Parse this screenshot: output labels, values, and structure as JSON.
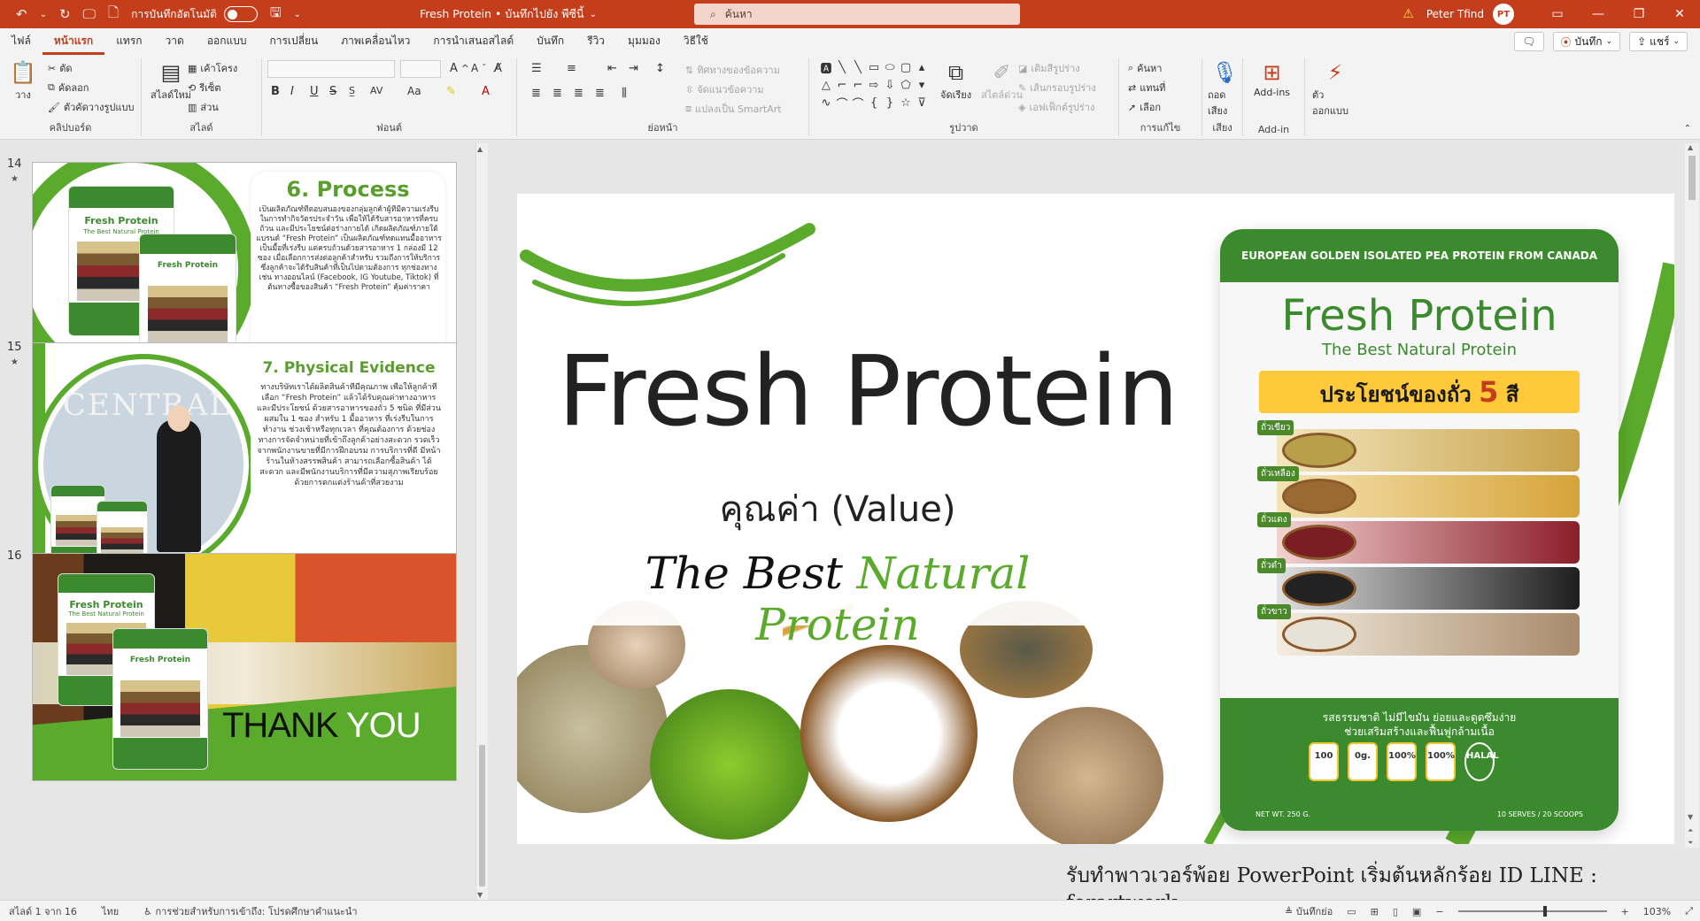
{
  "titlebar": {
    "autosave_label": "การบันทึกอัตโนมัติ",
    "doc_title": "Fresh Protein  •  บันทึกไปยัง พีซีนี้",
    "search_placeholder": "ค้นหา",
    "warning_icon": "warning-icon",
    "user_name": "Peter Tfind",
    "user_initials": "PT"
  },
  "tabs": [
    "ไฟล์",
    "หน้าแรก",
    "แทรก",
    "วาด",
    "ออกแบบ",
    "การเปลี่ยน",
    "ภาพเคลื่อนไหว",
    "การนำเสนอสไลด์",
    "บันทึก",
    "รีวิว",
    "มุมมอง",
    "วิธีใช้"
  ],
  "active_tab": "หน้าแรก",
  "tabs_right": {
    "comment_icon": "comment-icon",
    "record_label": "บันทึก",
    "share_label": "แชร์"
  },
  "ribbon": {
    "clipboard": {
      "label": "คลิปบอร์ด",
      "paste": "วาง",
      "cut": "ตัด",
      "copy": "คัดลอก",
      "format_painter": "ตัวคัดวางรูปแบบ"
    },
    "slides": {
      "label": "สไลด์",
      "new_slide": "สไลด์ใหม่",
      "layout": "เค้าโครง",
      "reset": "รีเซ็ต",
      "section": "ส่วน"
    },
    "font": {
      "label": "ฟอนต์",
      "bold": "B",
      "italic": "I",
      "underline": "U",
      "strike": "S",
      "spacing": "AV",
      "case": "Aa"
    },
    "paragraph": {
      "label": "ย่อหน้า",
      "text_direction": "ทิศทางของข้อความ",
      "align_text": "จัดแนวข้อความ",
      "smartart": "แปลงเป็น SmartArt"
    },
    "drawing": {
      "label": "รูปวาด",
      "arrange": "จัดเรียง",
      "quick_styles": "สไตล์ด่วน",
      "fill": "เติมสีรูปร่าง",
      "outline": "เส้นกรอบรูปร่าง",
      "effects": "เอฟเฟ็กต์รูปร่าง"
    },
    "editing": {
      "label": "การแก้ไข",
      "find": "ค้นหา",
      "replace": "แทนที่",
      "select": "เลือก"
    },
    "voice": {
      "label": "เสียง",
      "dictate": "ถอดเสียง"
    },
    "addins": {
      "label": "Add-in",
      "addins": "Add-ins"
    },
    "designer": {
      "label": "ตัวออกแบบ"
    }
  },
  "thumbnails": [
    {
      "num": "14",
      "title": "6. Process",
      "pack_title": "Fresh Protein",
      "pack_sub": "The Best Natural Protein",
      "text": "เป็นผลิตภัณฑ์ที่ตอบสนองของกลุ่มลูกค้าผู้ที่มีความเร่งรีบในการทำกิจวัตรประจำวัน เพื่อให้ได้รับสารอาหารที่ครบถ้วน และมีประโยชน์ต่อร่างกายได้ เกิดผลิตภัณฑ์ภายใต้แบรนด์ “Fresh Protein” เป็นผลิตภัณฑ์ทดแทนมื้ออาหาร เป็นมื้อที่เร่งรีบ แต่ครบถ้วนด้วยสารอาหาร 1 กล่องมี 12 ซอง เมื่อเลือกการส่งต่อลูกค้าสำหรับ รวมถึงการให้บริการซึ่งลูกค้าจะได้รับสินค้าที่เป็นไปตามต้องการ ทุกช่องทาง เช่น ทางออนไลน์ (Facebook, IG Youtube, Tiktok) ที่ต้นทางซื้อของสินค้า “Fresh Protein” คุ้มค่าราคา"
    },
    {
      "num": "15",
      "title": "7. Physical Evidence",
      "store_sign": "CENTRAL",
      "text": "ทางบริษัทเราได้ผลิตสินค้าที่มีคุณภาพ เพื่อให้ลูกค้าที่เลือก “Fresh Protein” แล้วได้รับคุณค่าทางอาหารและมีประโยชน์ ด้วยสารอาหารของถั่ว 5 ชนิด ที่มีส่วนผสมใน 1 ซอง สำหรับ 1 มื้ออาหาร ที่เร่งรีบในการทำงาน ช่วงเช้าหรือทุกเวลา ที่คุณต้องการ ด้วยช่องทางการจัดจำหน่ายที่เข้าถึงลูกค้าอย่างสะดวก รวดเร็ว จากพนักงานขายที่มีการฝึกอบรม การบริการที่ดี มีหน้าร้านในห้างสรรพสินค้า สามารถเลือกซื้อสินค้า ได้สะดวก และมีพนักงานบริการที่มีความสุภาพเรียบร้อย ด้วยการตกแต่งร้านค้าที่สวยงาม"
    },
    {
      "num": "16",
      "pack_title": "Fresh Protein",
      "pack_sub": "The Best Natural Protein",
      "thank": "THANK",
      "you": "YOU"
    }
  ],
  "main_slide": {
    "title": "Fresh Protein",
    "value": "คุณค่า (Value)",
    "tagline_a": "The Best",
    "tagline_b": "Natural Protein",
    "pack": {
      "band": "EUROPEAN GOLDEN ISOLATED PEA PROTEIN FROM CANADA",
      "title": "Fresh Protein",
      "subtitle": "The Best Natural Protein",
      "benefit": "ประโยชน์ของถั่ว",
      "benefit_num": "5",
      "benefit_unit": "สี",
      "beans": [
        "ถั่วเขียว",
        "ถั่วเหลือง",
        "ถั่วแดง",
        "ถั่วดำ",
        "ถั่วขาว"
      ],
      "bottom_text_1": "รสธรรมชาติ ไม่มีไขมัน ย่อยและดูดซึมง่าย",
      "bottom_text_2": "ช่วยเสริมสร้างและฟื้นฟูกล้ามเนื้อ",
      "nutrition": [
        "100",
        "0g.",
        "100%",
        "100%",
        "HALAL"
      ],
      "net": "NET WT. 250 G.",
      "serves": "10 SERVES / 20 SCOOPS"
    }
  },
  "footer_note": "รับทำพาวเวอร์พ้อย PowerPoint เริ่มต้นหลักร้อย ID LINE : forartwork",
  "statusbar": {
    "slide_info": "สไลด์ 1 จาก 16",
    "language": "ไทย",
    "accessibility": "การช่วยสำหรับการเข้าถึง: โปรดศึกษาคำแนะนำ",
    "notes": "บันทึกย่อ",
    "zoom": "103%"
  },
  "colors": {
    "accent": "#c43e1c",
    "brand_green": "#3b8a2e",
    "lime": "#5aaa2c"
  }
}
